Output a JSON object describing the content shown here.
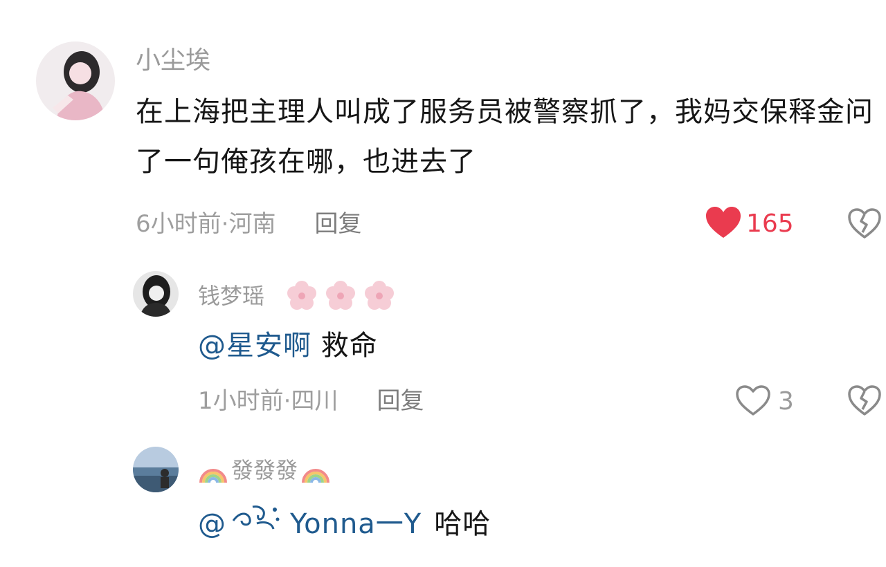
{
  "comment": {
    "username": "小尘埃",
    "text": "在上海把主理人叫成了服务员被警察抓了，我妈交保释金问了一句俺孩在哪，也进去了",
    "time": "6小时前",
    "location": "河南",
    "reply_label": "回复",
    "likes": "165",
    "liked": true
  },
  "replies": [
    {
      "username": "钱梦瑶",
      "mention": "@星安啊",
      "text": "救命",
      "time": "1小时前",
      "location": "四川",
      "reply_label": "回复",
      "likes": "3",
      "liked": false
    },
    {
      "username": "發發發",
      "mention_prefix": "@",
      "mention_name": "Yonna一Y",
      "text": "哈哈"
    }
  ],
  "separator": " · ",
  "watermark": "",
  "colors": {
    "like_red": "#ea3b4f",
    "mention_blue": "#1f5a8e",
    "meta_gray": "#9e9e9e"
  },
  "icons": {
    "like": "heart-icon",
    "dislike": "broken-heart-icon"
  }
}
